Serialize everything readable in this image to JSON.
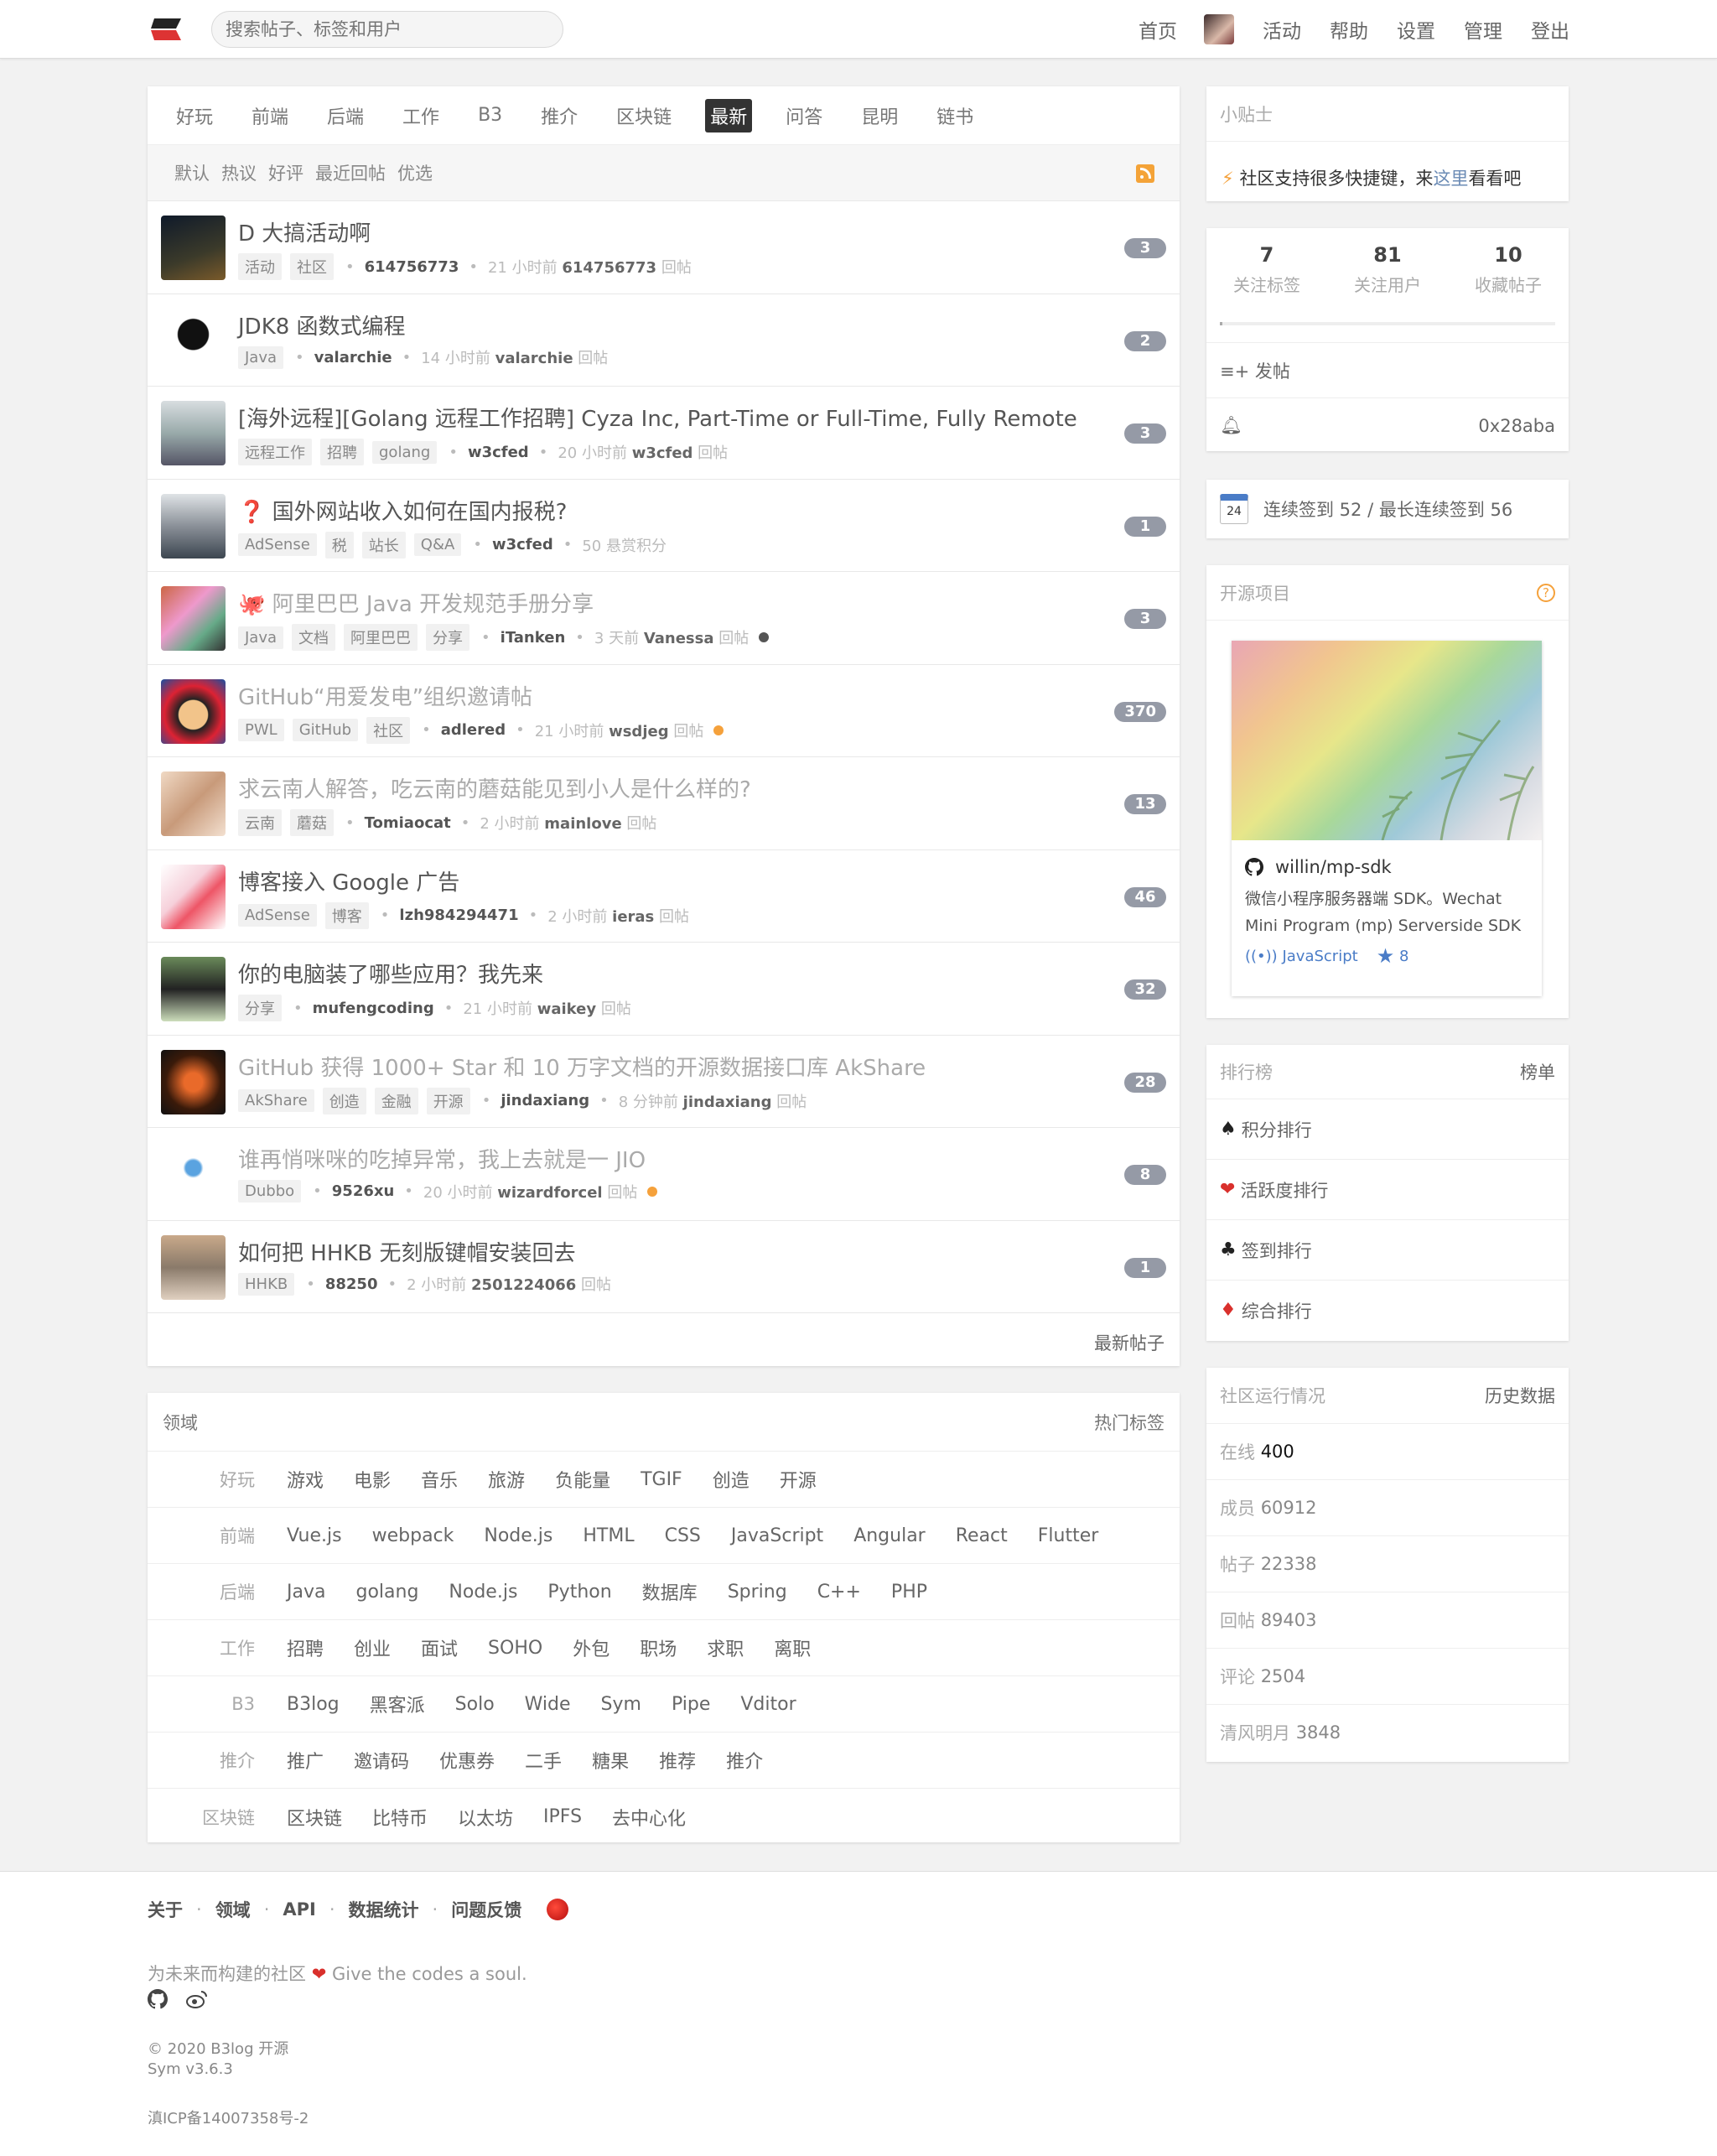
{
  "header": {
    "search_placeholder": "搜索帖子、标签和用户",
    "nav": [
      "首页",
      "活动",
      "帮助",
      "设置",
      "管理",
      "登出"
    ]
  },
  "tabs": [
    "好玩",
    "前端",
    "后端",
    "工作",
    "B3",
    "推介",
    "区块链",
    "最新",
    "问答",
    "昆明",
    "链书"
  ],
  "active_tab": "最新",
  "sort": [
    "默认",
    "热议",
    "好评",
    "最近回帖",
    "优选"
  ],
  "posts": [
    {
      "title": "D 大搞活动啊",
      "tags": [
        "活动",
        "社区"
      ],
      "author": "614756773",
      "time": "21 小时前",
      "reply_user": "614756773",
      "reply_label": "回帖",
      "count": "3",
      "faded": false
    },
    {
      "title": "JDK8 函数式编程",
      "tags": [
        "Java"
      ],
      "author": "valarchie",
      "time": "14 小时前",
      "reply_user": "valarchie",
      "reply_label": "回帖",
      "count": "2",
      "faded": false
    },
    {
      "title": "[海外远程][Golang 远程工作招聘] Cyza Inc, Part-Time or Full-Time, Fully Remote",
      "tags": [
        "远程工作",
        "招聘",
        "golang"
      ],
      "author": "w3cfed",
      "time": "20 小时前",
      "reply_user": "w3cfed",
      "reply_label": "回帖",
      "count": "3",
      "faded": false
    },
    {
      "title": "❓ 国外网站收入如何在国内报税?",
      "tags": [
        "AdSense",
        "税",
        "站长",
        "Q&A"
      ],
      "author": "w3cfed",
      "time": "50 悬赏积分",
      "reply_user": "",
      "reply_label": "",
      "count": "1",
      "faded": false
    },
    {
      "title": "🐙 阿里巴巴 Java 开发规范手册分享",
      "tags": [
        "Java",
        "文档",
        "阿里巴巴",
        "分享"
      ],
      "author": "iTanken",
      "time": "3 天前",
      "reply_user": "Vanessa",
      "reply_label": "回帖",
      "count": "3",
      "faded": true,
      "dot": "#555"
    },
    {
      "title": "GitHub“用爱发电”组织邀请帖",
      "tags": [
        "PWL",
        "GitHub",
        "社区"
      ],
      "author": "adlered",
      "time": "21 小时前",
      "reply_user": "wsdjeg",
      "reply_label": "回帖",
      "count": "370",
      "faded": true,
      "dot": "#f5a13b"
    },
    {
      "title": "求云南人解答，吃云南的蘑菇能见到小人是什么样的?",
      "tags": [
        "云南",
        "蘑菇"
      ],
      "author": "Tomiaocat",
      "time": "2 小时前",
      "reply_user": "mainlove",
      "reply_label": "回帖",
      "count": "13",
      "faded": true
    },
    {
      "title": "博客接入 Google 广告",
      "tags": [
        "AdSense",
        "博客"
      ],
      "author": "lzh984294471",
      "time": "2 小时前",
      "reply_user": "ieras",
      "reply_label": "回帖",
      "count": "46",
      "faded": false
    },
    {
      "title": "你的电脑装了哪些应用？我先来",
      "tags": [
        "分享"
      ],
      "author": "mufengcoding",
      "time": "21 小时前",
      "reply_user": "waikey",
      "reply_label": "回帖",
      "count": "32",
      "faded": false
    },
    {
      "title": "GitHub 获得 1000+ Star 和 10 万字文档的开源数据接口库 AkShare",
      "tags": [
        "AkShare",
        "创造",
        "金融",
        "开源"
      ],
      "author": "jindaxiang",
      "time": "8 分钟前",
      "reply_user": "jindaxiang",
      "reply_label": "回帖",
      "count": "28",
      "faded": true
    },
    {
      "title": "谁再悄咪咪的吃掉异常，我上去就是一 JIO",
      "tags": [
        "Dubbo"
      ],
      "author": "9526xu",
      "time": "20 小时前",
      "reply_user": "wizardforcel",
      "reply_label": "回帖",
      "count": "8",
      "faded": true,
      "dot": "#f5a13b"
    },
    {
      "title": "如何把 HHKB 无刻版键帽安装回去",
      "tags": [
        "HHKB"
      ],
      "author": "88250",
      "time": "2 小时前",
      "reply_user": "2501224066",
      "reply_label": "回帖",
      "count": "1",
      "faded": false
    }
  ],
  "more_label": "最新帖子",
  "domains": {
    "title": "领域",
    "right": "热门标签",
    "rows": [
      {
        "name": "好玩",
        "items": [
          "游戏",
          "电影",
          "音乐",
          "旅游",
          "负能量",
          "TGIF",
          "创造",
          "开源"
        ]
      },
      {
        "name": "前端",
        "items": [
          "Vue.js",
          "webpack",
          "Node.js",
          "HTML",
          "CSS",
          "JavaScript",
          "Angular",
          "React",
          "Flutter"
        ]
      },
      {
        "name": "后端",
        "items": [
          "Java",
          "golang",
          "Node.js",
          "Python",
          "数据库",
          "Spring",
          "C++",
          "PHP"
        ]
      },
      {
        "name": "工作",
        "items": [
          "招聘",
          "创业",
          "面试",
          "SOHO",
          "外包",
          "职场",
          "求职",
          "离职"
        ]
      },
      {
        "name": "B3",
        "items": [
          "B3log",
          "黑客派",
          "Solo",
          "Wide",
          "Sym",
          "Pipe",
          "Vditor"
        ]
      },
      {
        "name": "推介",
        "items": [
          "推广",
          "邀请码",
          "优惠券",
          "二手",
          "糖果",
          "推荐",
          "推介"
        ]
      },
      {
        "name": "区块链",
        "items": [
          "区块链",
          "比特币",
          "以太坊",
          "IPFS",
          "去中心化"
        ]
      }
    ]
  },
  "tip": {
    "title": "小贴士",
    "pre": "社区支持很多快捷键，来",
    "link": "这里",
    "post": "看看吧"
  },
  "stats": [
    {
      "num": "7",
      "label": "关注标签"
    },
    {
      "num": "81",
      "label": "关注用户"
    },
    {
      "num": "10",
      "label": "收藏帖子"
    }
  ],
  "post_btn": "发帖",
  "notify_user": "0x28aba",
  "checkin": {
    "day": "24",
    "text": "连续签到 52 / 最长连续签到 56"
  },
  "opensource": {
    "title": "开源项目",
    "repo": "willin/mp-sdk",
    "desc": "微信小程序服务器端 SDK。Wechat Mini Program (mp) Serverside SDK",
    "lang": "JavaScript",
    "stars": "8"
  },
  "rank": {
    "title": "排行榜",
    "right": "榜单",
    "items": [
      {
        "icon": "♠",
        "label": "积分排行",
        "color": "#222"
      },
      {
        "icon": "❤",
        "label": "活跃度排行",
        "color": "#d9302c"
      },
      {
        "icon": "♣",
        "label": "签到排行",
        "color": "#222"
      },
      {
        "icon": "♦",
        "label": "综合排行",
        "color": "#d9302c"
      }
    ]
  },
  "community": {
    "title": "社区运行情况",
    "right": "历史数据",
    "rows": [
      {
        "label": "在线",
        "value": "400"
      },
      {
        "label": "成员",
        "value": "60912"
      },
      {
        "label": "帖子",
        "value": "22338"
      },
      {
        "label": "回帖",
        "value": "89403"
      },
      {
        "label": "评论",
        "value": "2504"
      },
      {
        "label": "清风明月",
        "value": "3848"
      }
    ]
  },
  "footer": {
    "links": [
      "关于",
      "领域",
      "API",
      "数据统计",
      "问题反馈"
    ],
    "slogan_pre": "为未来而构建的社区",
    "slogan_post": "Give the codes a soul.",
    "copyright": "© 2020 B3log 开源",
    "version": "Sym v3.6.3",
    "icp": "滇ICP备14007358号-2"
  }
}
